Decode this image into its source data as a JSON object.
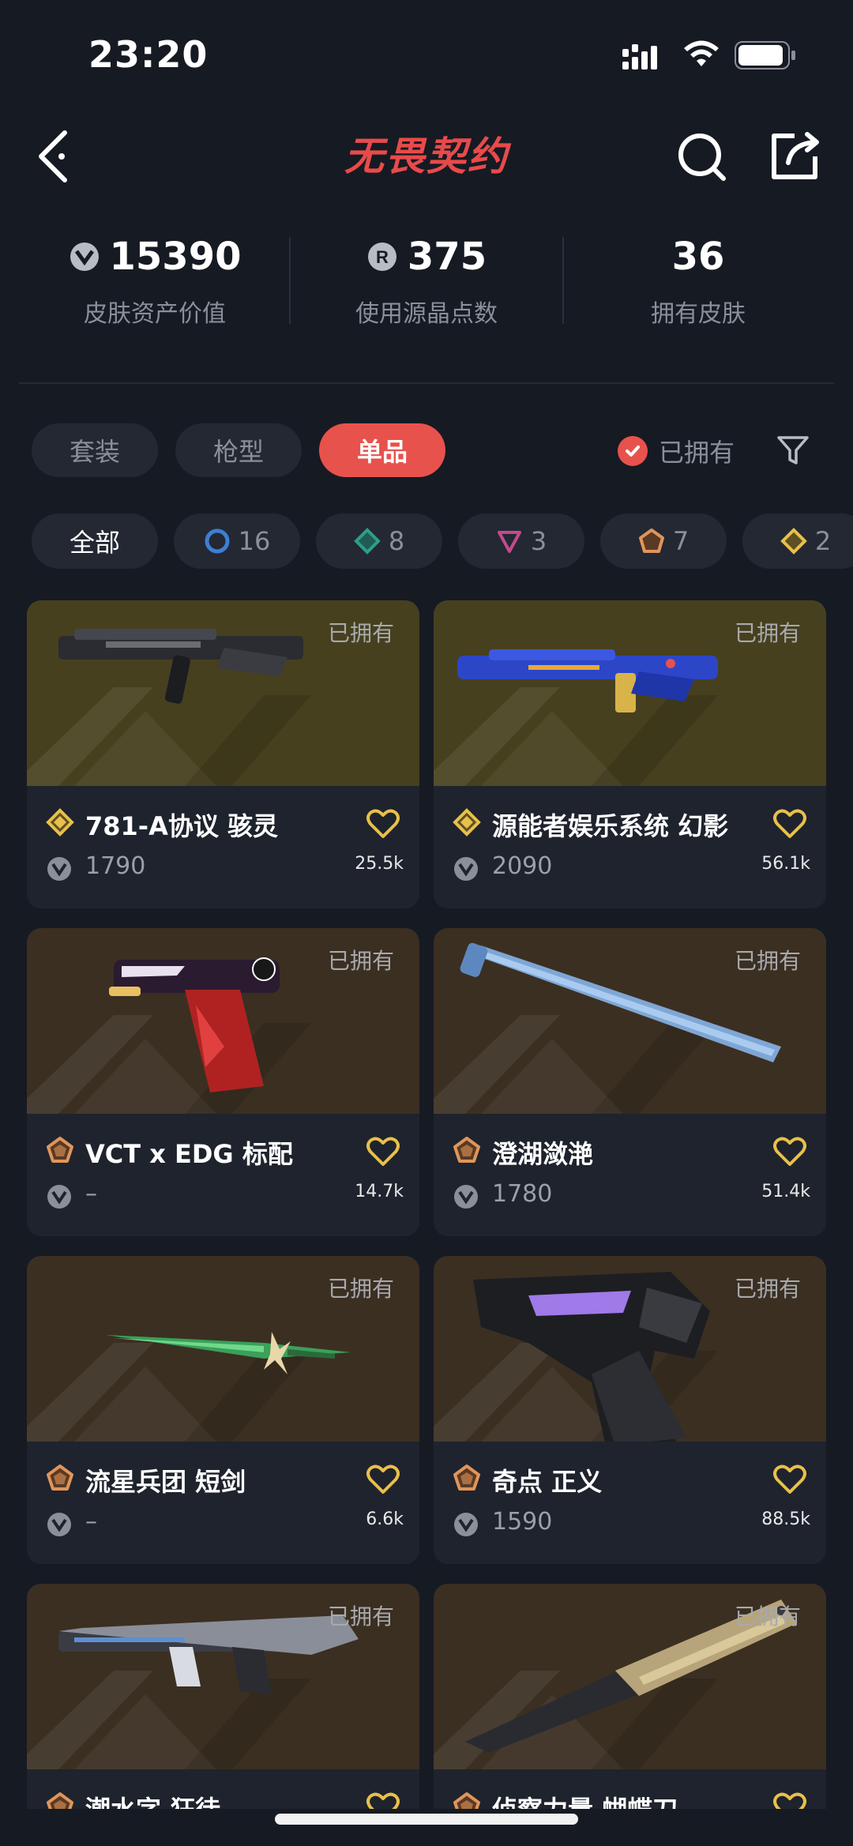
{
  "status_bar": {
    "time": "23:20"
  },
  "header": {
    "title": "无畏契约"
  },
  "stats": [
    {
      "value": "15390",
      "label": "皮肤资产价值",
      "icon": "vp-icon"
    },
    {
      "value": "375",
      "label": "使用源晶点数",
      "icon": "radianite-icon"
    },
    {
      "value": "36",
      "label": "拥有皮肤",
      "icon": ""
    }
  ],
  "tabs": [
    {
      "label": "套装",
      "active": false
    },
    {
      "label": "枪型",
      "active": false
    },
    {
      "label": "单品",
      "active": true
    }
  ],
  "owned_filter": {
    "label": "已拥有",
    "checked": true
  },
  "rarity_filters": [
    {
      "label": "全部",
      "icon": "",
      "color": ""
    },
    {
      "label": "16",
      "icon": "select-tier-icon",
      "color": "#3d7fd4"
    },
    {
      "label": "8",
      "icon": "deluxe-tier-icon",
      "color": "#2f9d8b"
    },
    {
      "label": "3",
      "icon": "premium-tier-icon",
      "color": "#c14a8b"
    },
    {
      "label": "7",
      "icon": "exclusive-tier-icon",
      "color": "#e0955a"
    },
    {
      "label": "2",
      "icon": "ultra-tier-icon",
      "color": "#e8c04a"
    }
  ],
  "skins": [
    {
      "owned": "已拥有",
      "name": "781-A协议 骇灵",
      "tier": "ultra-tier-icon",
      "tier_color": "#e8c04a",
      "price": "1790",
      "likes": "25.5k",
      "art": "rifle-dark-icon",
      "bg": "#47401f"
    },
    {
      "owned": "已拥有",
      "name": "源能者娱乐系统 幻影",
      "tier": "ultra-tier-icon",
      "tier_color": "#e8c04a",
      "price": "2090",
      "likes": "56.1k",
      "art": "rifle-blue-icon",
      "bg": "#47401f"
    },
    {
      "owned": "已拥有",
      "name": "VCT x EDG 标配",
      "tier": "exclusive-tier-icon",
      "tier_color": "#e0955a",
      "price": "–",
      "likes": "14.7k",
      "art": "pistol-red-icon",
      "bg": "#3b2f22"
    },
    {
      "owned": "已拥有",
      "name": "澄湖潋滟",
      "tier": "exclusive-tier-icon",
      "tier_color": "#e0955a",
      "price": "1780",
      "likes": "51.4k",
      "art": "blade-blue-icon",
      "bg": "#3b2f22"
    },
    {
      "owned": "已拥有",
      "name": "流星兵团 短剑",
      "tier": "exclusive-tier-icon",
      "tier_color": "#e0955a",
      "price": "–",
      "likes": "6.6k",
      "art": "dagger-green-icon",
      "bg": "#3b2f22"
    },
    {
      "owned": "已拥有",
      "name": "奇点 正义",
      "tier": "exclusive-tier-icon",
      "tier_color": "#e0955a",
      "price": "1590",
      "likes": "88.5k",
      "art": "revolver-dark-icon",
      "bg": "#3b2f22"
    },
    {
      "owned": "已拥有",
      "name": "潮水字 狂徒",
      "tier": "exclusive-tier-icon",
      "tier_color": "#e0955a",
      "price": "",
      "likes": "",
      "art": "rifle-silver-icon",
      "bg": "#3b2f22"
    },
    {
      "owned": "已拥有",
      "name": "侦察力量 蝴蝶刀",
      "tier": "exclusive-tier-icon",
      "tier_color": "#e0955a",
      "price": "",
      "likes": "",
      "art": "knife-tan-icon",
      "bg": "#3b2f22"
    }
  ]
}
